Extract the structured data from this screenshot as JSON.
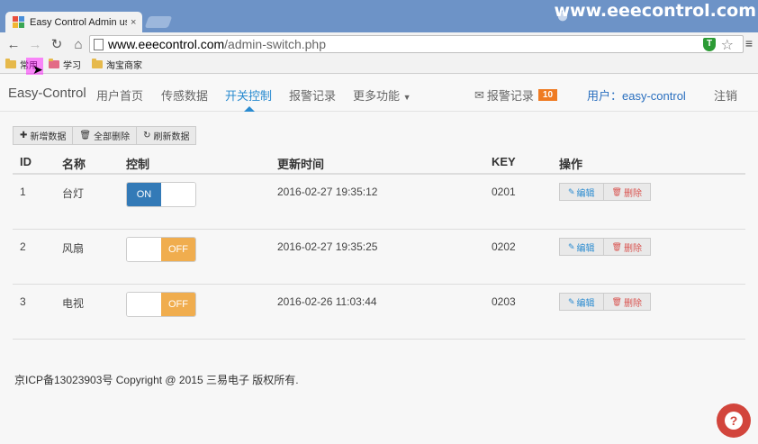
{
  "browser": {
    "tab_title": "Easy Control Admin use",
    "tab_close": "×",
    "watermark": "www.eeecontrol.com",
    "url_host": "www.eeecontrol.com",
    "url_path": "/admin-switch.php",
    "bookmarks": [
      "常用",
      "学习",
      "淘宝商家"
    ],
    "favicon_colors": [
      "#e94e3c",
      "#4a8fd9",
      "#f2b632",
      "#3aa655"
    ]
  },
  "navbar": {
    "brand": "Easy-Control",
    "items": [
      "用户首页",
      "传感数据",
      "开关控制",
      "报警记录",
      "更多功能"
    ],
    "active_index": 2,
    "alarm_label": "报警记录",
    "alarm_count": "10",
    "user_label": "用户：easy-control",
    "logout": "注销"
  },
  "toolbar": {
    "add_label": "新增数据",
    "delete_all_label": "全部删除",
    "refresh_label": "刷新数据"
  },
  "table": {
    "headers": [
      "ID",
      "名称",
      "控制",
      "更新时间",
      "KEY",
      "操作"
    ],
    "rows": [
      {
        "id": "1",
        "name": "台灯",
        "state": "ON",
        "time": "2016-02-27 19:35:12",
        "key": "0201"
      },
      {
        "id": "2",
        "name": "风扇",
        "state": "OFF",
        "time": "2016-02-27 19:35:25",
        "key": "0202"
      },
      {
        "id": "3",
        "name": "电视",
        "state": "OFF",
        "time": "2016-02-26 11:03:44",
        "key": "0203"
      }
    ],
    "edit_label": "编辑",
    "delete_label": "删除"
  },
  "footer": "京ICP备13023903号 Copyright @ 2015 三易电子 版权所有.",
  "help_label": "?",
  "colors": {
    "accent": "#2a8bd0",
    "switch_on": "#337ab7",
    "switch_off": "#f0ad4e",
    "badge": "#ef7b22",
    "help": "#d2453c"
  }
}
